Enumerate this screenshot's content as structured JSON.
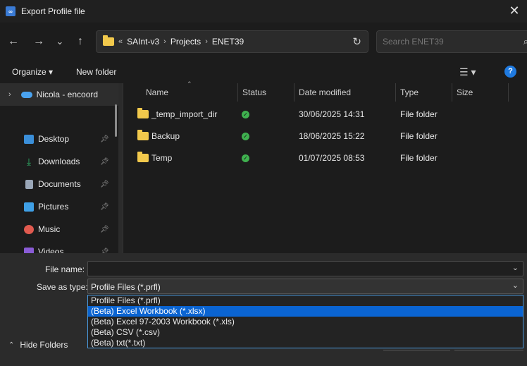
{
  "window": {
    "title": "Export Profile file"
  },
  "nav": {
    "back": "←",
    "forward": "→",
    "recent": "⌄",
    "up": "↑",
    "breadcrumb": [
      "SAInt-v3",
      "Projects",
      "ENET39"
    ],
    "breadcrumb_prefix": "«",
    "search_placeholder": "Search ENET39"
  },
  "commands": {
    "organize": "Organize ▾",
    "new_folder": "New folder"
  },
  "sidebar": {
    "top_item": "Nicola - encoord",
    "items": [
      {
        "label": "Desktop",
        "icon": "desktop-icon",
        "color": "#3b8fd9"
      },
      {
        "label": "Downloads",
        "icon": "download-icon",
        "color": "#2fb56a"
      },
      {
        "label": "Documents",
        "icon": "document-icon",
        "color": "#9aa7b8"
      },
      {
        "label": "Pictures",
        "icon": "picture-icon",
        "color": "#3fa0e6"
      },
      {
        "label": "Music",
        "icon": "music-icon",
        "color": "#e05a4f"
      },
      {
        "label": "Videos",
        "icon": "video-icon",
        "color": "#8a5cd6"
      }
    ]
  },
  "columns": {
    "name": "Name",
    "status": "Status",
    "date": "Date modified",
    "type": "Type",
    "size": "Size"
  },
  "files": [
    {
      "name": "_temp_import_dir",
      "date": "30/06/2025 14:31",
      "type": "File folder"
    },
    {
      "name": "Backup",
      "date": "18/06/2025 15:22",
      "type": "File folder"
    },
    {
      "name": "Temp",
      "date": "01/07/2025 08:53",
      "type": "File folder"
    }
  ],
  "form": {
    "file_name_label": "File name:",
    "file_name_value": "",
    "save_type_label": "Save as type:",
    "save_type_value": "Profile Files (*.prfl)",
    "type_options": [
      "Profile Files (*.prfl)",
      "(Beta) Excel Workbook (*.xlsx)",
      "(Beta) Excel 97-2003 Workbook (*.xls)",
      "(Beta) CSV (*.csv)",
      "(Beta) txt(*.txt)"
    ],
    "selected_option_index": 1
  },
  "footer": {
    "hide_folders": "Hide Folders"
  },
  "colors": {
    "accent": "#0a64d2",
    "folder": "#f2c94c",
    "status_ok": "#3fb14f"
  }
}
